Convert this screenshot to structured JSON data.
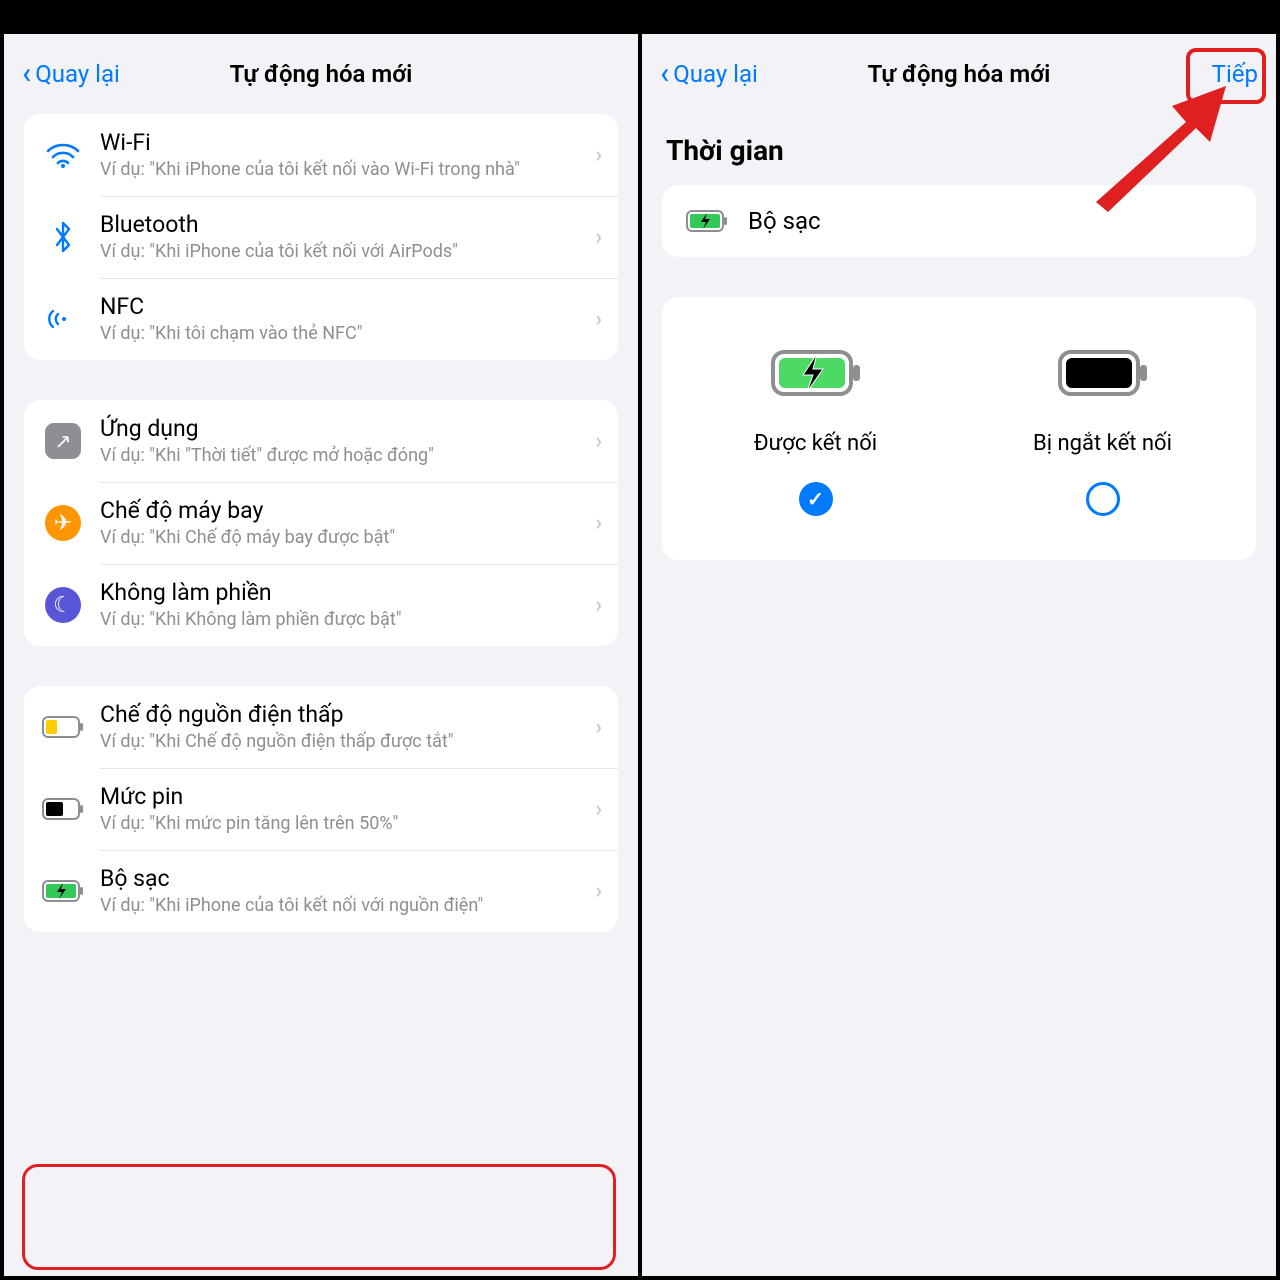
{
  "left": {
    "nav": {
      "back": "Quay lại",
      "title": "Tự động hóa mới"
    },
    "groups": [
      {
        "rows": [
          {
            "icon": "wifi-icon",
            "title": "Wi-Fi",
            "sub": "Ví dụ: \"Khi iPhone của tôi kết nối vào Wi-Fi trong nhà\""
          },
          {
            "icon": "bluetooth-icon",
            "title": "Bluetooth",
            "sub": "Ví dụ: \"Khi iPhone của tôi kết nối với AirPods\""
          },
          {
            "icon": "nfc-icon",
            "title": "NFC",
            "sub": "Ví dụ: \"Khi tôi chạm vào thẻ NFC\""
          }
        ]
      },
      {
        "rows": [
          {
            "icon": "app-icon",
            "title": "Ứng dụng",
            "sub": "Ví dụ: \"Khi \"Thời tiết\" được mở hoặc đóng\""
          },
          {
            "icon": "airplane-icon",
            "title": "Chế độ máy bay",
            "sub": "Ví dụ: \"Khi Chế độ máy bay được bật\""
          },
          {
            "icon": "dnd-icon",
            "title": "Không làm phiền",
            "sub": "Ví dụ: \"Khi Không làm phiền được bật\""
          }
        ]
      },
      {
        "rows": [
          {
            "icon": "low-power-icon",
            "title": "Chế độ nguồn điện thấp",
            "sub": "Ví dụ: \"Khi Chế độ nguồn điện thấp được tắt\""
          },
          {
            "icon": "battery-level-icon",
            "title": "Mức pin",
            "sub": "Ví dụ: \"Khi mức pin tăng lên trên 50%\""
          },
          {
            "icon": "charger-icon",
            "title": "Bộ sạc",
            "sub": "Ví dụ: \"Khi iPhone của tôi kết nối với nguồn điện\"",
            "highlighted": true
          }
        ]
      }
    ]
  },
  "right": {
    "nav": {
      "back": "Quay lại",
      "title": "Tự động hóa mới",
      "action": "Tiếp"
    },
    "section": "Thời gian",
    "selected_trigger": "Bộ sạc",
    "choices": [
      {
        "label": "Được kết nối",
        "selected": true
      },
      {
        "label": "Bị ngắt kết nối",
        "selected": false
      }
    ]
  },
  "colors": {
    "accent": "#007aff",
    "highlight": "#e02020"
  }
}
